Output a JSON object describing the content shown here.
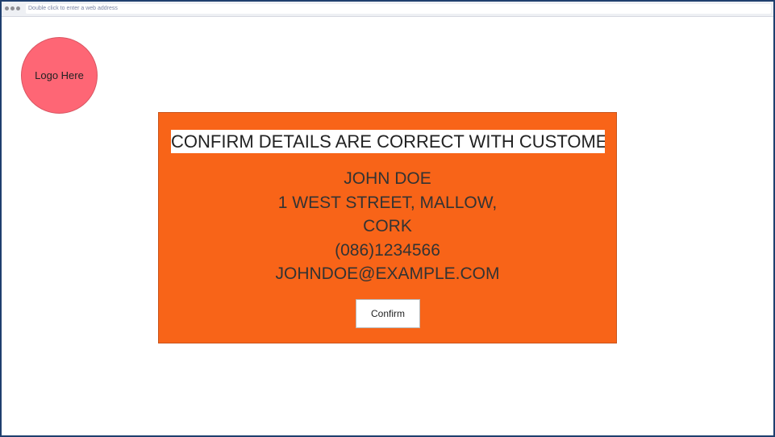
{
  "browser": {
    "address_placeholder": "Double click to enter a web address"
  },
  "logo": {
    "label": "Logo Here"
  },
  "confirm_panel": {
    "heading": "CONFIRM DETAILS ARE CORRECT WITH CUSTOMER!",
    "name": "JOHN DOE",
    "address_line1": "1 WEST STREET, MALLOW,",
    "address_line2": "CORK",
    "phone": "(086)1234566",
    "email": "JOHNDOE@EXAMPLE.COM",
    "confirm_label": "Confirm"
  },
  "colors": {
    "panel_background": "#f86418",
    "logo_background": "#fe6675",
    "frame_border": "#1f3f6e"
  }
}
